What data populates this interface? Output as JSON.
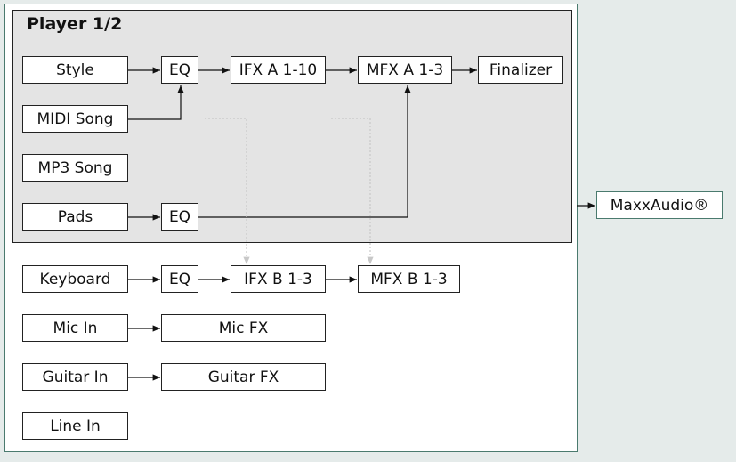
{
  "group": {
    "title": "Player 1/2"
  },
  "blocks": {
    "style": "Style",
    "eq1": "EQ",
    "ifx_a": "IFX A 1-10",
    "mfx_a": "MFX A 1-3",
    "finalizer": "Finalizer",
    "midi_song": "MIDI Song",
    "mp3_song": "MP3 Song",
    "pads": "Pads",
    "eq2": "EQ",
    "keyboard": "Keyboard",
    "eq3": "EQ",
    "ifx_b": "IFX B 1-3",
    "mfx_b": "MFX B 1-3",
    "mic_in": "Mic In",
    "mic_fx": "Mic FX",
    "guitar_in": "Guitar In",
    "guitar_fx": "Guitar FX",
    "line_in": "Line In",
    "maxxaudio": "MaxxAudio®"
  },
  "colors": {
    "frame": "#4a7a6e",
    "group_bg": "#e4e4e4",
    "page_bg": "#e5ebea"
  }
}
